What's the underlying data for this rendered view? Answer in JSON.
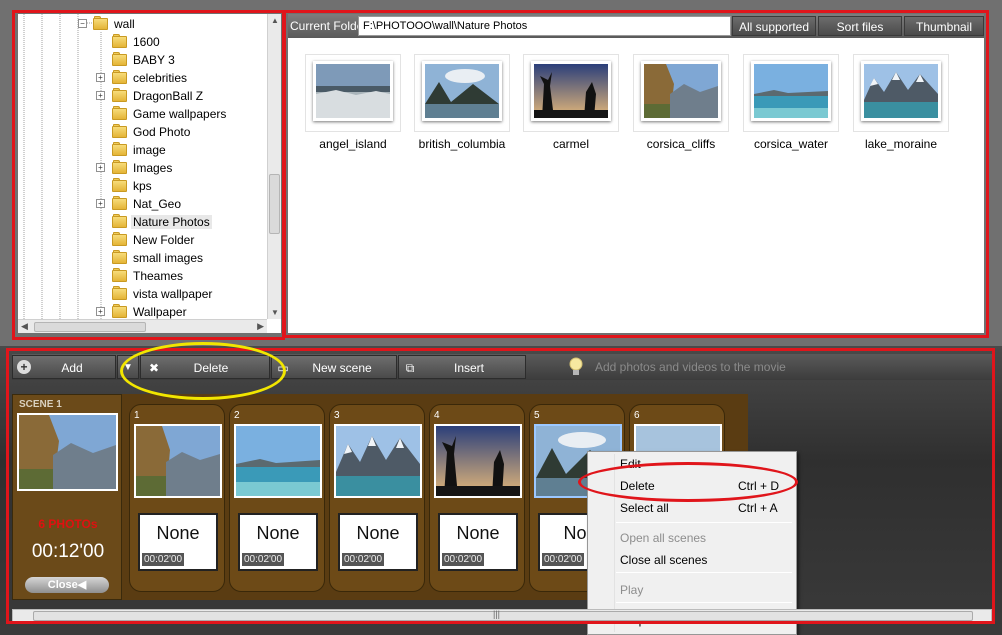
{
  "tree": {
    "root_label": "wall",
    "items": [
      {
        "label": "1600",
        "expandable": false
      },
      {
        "label": "BABY 3",
        "expandable": false
      },
      {
        "label": "celebrities",
        "expandable": true
      },
      {
        "label": "DragonBall Z",
        "expandable": true
      },
      {
        "label": "Game wallpapers",
        "expandable": false
      },
      {
        "label": "God Photo",
        "expandable": false
      },
      {
        "label": "image",
        "expandable": false
      },
      {
        "label": "Images",
        "expandable": true
      },
      {
        "label": "kps",
        "expandable": false
      },
      {
        "label": "Nat_Geo",
        "expandable": true
      },
      {
        "label": "Nature Photos",
        "expandable": false,
        "selected": true
      },
      {
        "label": "New Folder",
        "expandable": false
      },
      {
        "label": "small images",
        "expandable": false
      },
      {
        "label": "Theames",
        "expandable": false
      },
      {
        "label": "vista wallpaper",
        "expandable": false
      },
      {
        "label": "Wallpaper",
        "expandable": true
      }
    ]
  },
  "browser": {
    "current_folder_label": "Current Folder",
    "current_folder_path": "F:\\PHOTOOO\\wall\\Nature Photos",
    "buttons": {
      "all_supported": "All supported",
      "sort_files": "Sort files",
      "thumbnail_size": "Thumbnail size"
    },
    "files": [
      "angel_island",
      "british_columbia",
      "carmel",
      "corsica_cliffs",
      "corsica_water",
      "lake_moraine"
    ]
  },
  "toolbar": {
    "add": "Add",
    "dropdown_arrow": "▼",
    "delete": "Delete",
    "new_scene": "New scene",
    "insert": "Insert",
    "hint": "Add photos and videos to the movie"
  },
  "scene": {
    "title": "SCENE 1",
    "photo_count": "6 PHOTOs",
    "duration": "00:12'00",
    "close": "Close◀"
  },
  "photos": [
    {
      "num": "1",
      "transition": "None",
      "duration": "00:02'00"
    },
    {
      "num": "2",
      "transition": "None",
      "duration": "00:02'00"
    },
    {
      "num": "3",
      "transition": "None",
      "duration": "00:02'00"
    },
    {
      "num": "4",
      "transition": "None",
      "duration": "00:02'00"
    },
    {
      "num": "5",
      "transition": "Nor",
      "duration": "00:02'00"
    },
    {
      "num": "6",
      "transition": "",
      "duration": ""
    }
  ],
  "context_menu": {
    "items": [
      {
        "label": "Edit",
        "shortcut": "",
        "disabled": false
      },
      {
        "label": "Delete",
        "shortcut": "Ctrl + D",
        "disabled": false
      },
      {
        "label": "Select all",
        "shortcut": "Ctrl + A",
        "disabled": false
      },
      {
        "label": "Open all scenes",
        "shortcut": "",
        "disabled": true
      },
      {
        "label": "Close all scenes",
        "shortcut": "",
        "disabled": false
      },
      {
        "label": "Play",
        "shortcut": "",
        "disabled": true
      },
      {
        "label": "Properties",
        "shortcut": "",
        "disabled": false
      }
    ]
  },
  "colors": {
    "highlight_red": "#e0151b",
    "highlight_yellow": "#f2e600",
    "scene_brown": "#6d4a17"
  }
}
